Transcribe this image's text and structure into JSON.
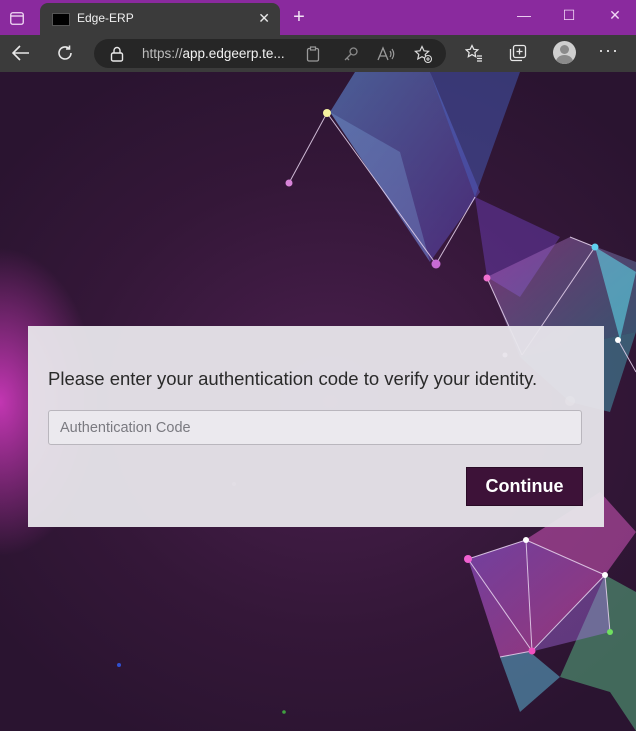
{
  "browser": {
    "tab": {
      "title": "Edge-ERP",
      "close": "✕"
    },
    "new_tab": "+",
    "window_controls": {
      "minimize": "—",
      "maximize": "☐",
      "close": "✕"
    },
    "address": {
      "url_prefix": "https://",
      "url_host": "app.edgeerp.te..."
    },
    "menu": "···"
  },
  "colors": {
    "tabstrip": "#8a2a9e",
    "toolbar": "#3b3b3b",
    "continue_button": "#3d1238"
  },
  "form": {
    "prompt": "Please enter your authentication code to verify your identity.",
    "code_placeholder": "Authentication Code",
    "code_value": "",
    "continue_label": "Continue"
  }
}
